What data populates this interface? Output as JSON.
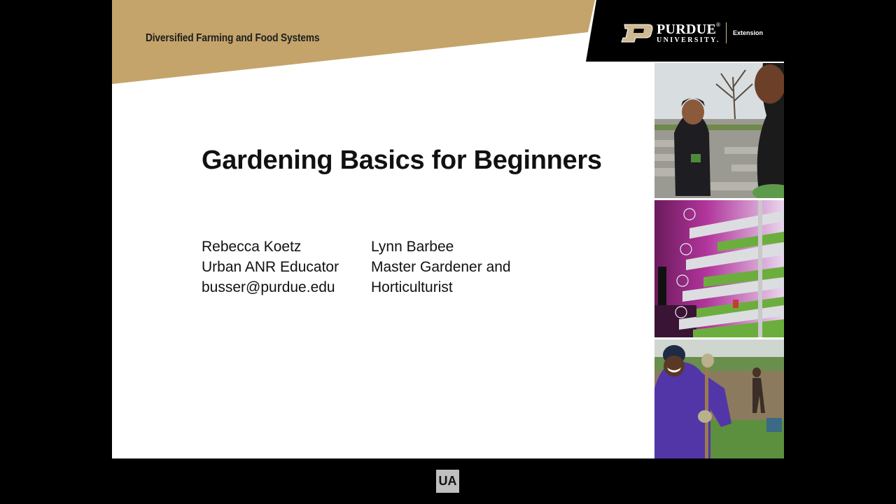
{
  "slide": {
    "header": {
      "subtitle": "Diversified Farming and Food Systems",
      "brand_color": "#c4a46a",
      "logo": {
        "mark_icon": "purdue-p-icon",
        "name": "PURDUE",
        "sub": "UNIVERSITY.",
        "trademark": "®",
        "extension": "Extension"
      }
    },
    "title": "Gardening Basics for Beginners",
    "presenters": [
      {
        "lines": [
          "Rebecca Koetz",
          "Urban ANR Educator",
          "busser@purdue.edu"
        ]
      },
      {
        "lines": [
          "Lynn Barbee",
          "Master Gardener and",
          "Horticulturist"
        ]
      }
    ],
    "photos": [
      {
        "name": "community-garden-photo"
      },
      {
        "name": "hydroponic-rack-photo"
      },
      {
        "name": "farmer-shovel-photo"
      }
    ]
  },
  "player": {
    "badge": "UA"
  }
}
